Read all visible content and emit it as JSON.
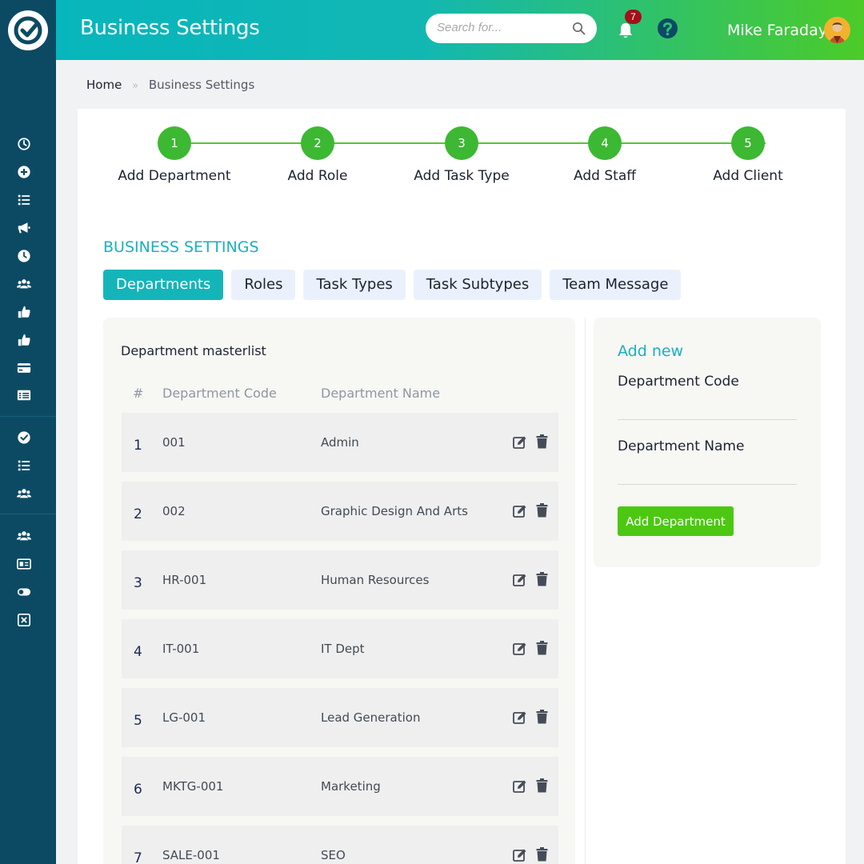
{
  "header": {
    "title": "Business Settings",
    "search_placeholder": "Search for...",
    "notification_count": "7",
    "user_name": "Mike Faraday"
  },
  "breadcrumb": {
    "home": "Home",
    "separator": "»",
    "current": "Business Settings"
  },
  "steps": [
    {
      "number": "1",
      "label": "Add Department"
    },
    {
      "number": "2",
      "label": "Add Role"
    },
    {
      "number": "3",
      "label": "Add Task Type"
    },
    {
      "number": "4",
      "label": "Add Staff"
    },
    {
      "number": "5",
      "label": "Add Client"
    }
  ],
  "section_title": "BUSINESS SETTINGS",
  "tabs": [
    {
      "label": "Departments",
      "active": true
    },
    {
      "label": "Roles",
      "active": false
    },
    {
      "label": "Task Types",
      "active": false
    },
    {
      "label": "Task Subtypes",
      "active": false
    },
    {
      "label": "Team Message",
      "active": false
    }
  ],
  "masterlist": {
    "title": "Department masterlist",
    "columns": [
      "#",
      "Department Code",
      "Department Name"
    ],
    "rows": [
      {
        "num": "1",
        "code": "001",
        "name": "Admin"
      },
      {
        "num": "2",
        "code": "002",
        "name": "Graphic Design And Arts"
      },
      {
        "num": "3",
        "code": "HR-001",
        "name": "Human Resources"
      },
      {
        "num": "4",
        "code": "IT-001",
        "name": "IT Dept"
      },
      {
        "num": "5",
        "code": "LG-001",
        "name": "Lead Generation"
      },
      {
        "num": "6",
        "code": "MKTG-001",
        "name": "Marketing"
      },
      {
        "num": "7",
        "code": "SALE-001",
        "name": "SEO"
      }
    ]
  },
  "add_form": {
    "title": "Add new",
    "code_label": "Department Code",
    "code_value": "",
    "name_label": "Department Name",
    "name_value": "",
    "submit_label": "Add Department"
  },
  "colors": {
    "sidebar": "#0c4a63",
    "accent": "#14b5b9",
    "step_green": "#3cb832",
    "button_green": "#4cc812"
  },
  "sidebar_icons": [
    "clock-icon",
    "plus-circle-icon",
    "list-icon",
    "megaphone-icon",
    "clock-filled-icon",
    "users-icon",
    "thumbs-up-icon",
    "thumbs-up-icon",
    "credit-card-icon",
    "table-icon",
    "check-circle-icon",
    "list-icon",
    "users-icon",
    "users-icon",
    "id-card-icon",
    "toggle-icon",
    "close-box-icon"
  ]
}
